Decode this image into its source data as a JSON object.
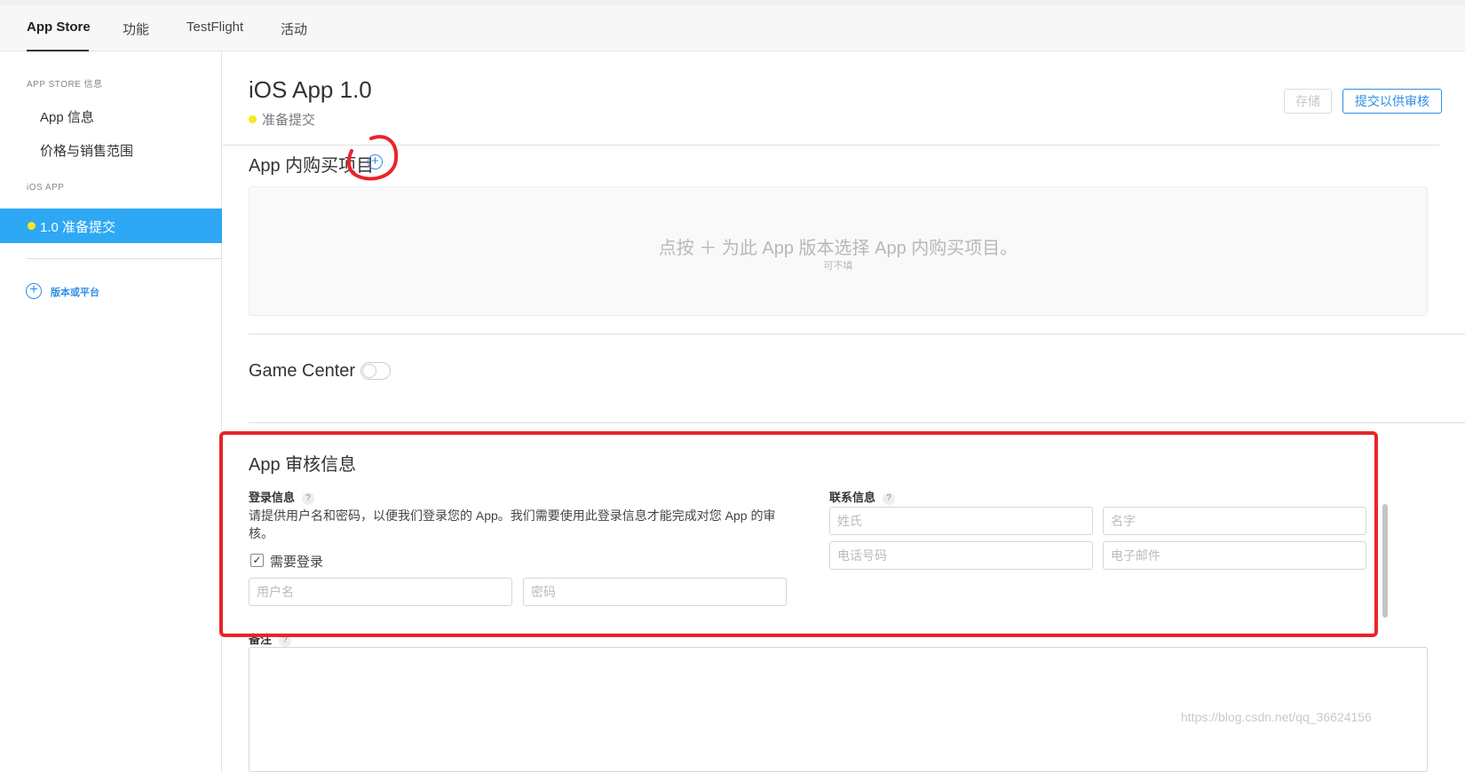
{
  "tabs": [
    {
      "label": "App Store"
    },
    {
      "label": "功能"
    },
    {
      "label": "TestFlight"
    },
    {
      "label": "活动"
    }
  ],
  "sidebar": {
    "section1_header": "APP STORE 信息",
    "items": [
      {
        "label": "App 信息"
      },
      {
        "label": "价格与销售范围"
      }
    ],
    "section2_header": "iOS APP",
    "active_version": "1.0 准备提交",
    "add_platform": "版本或平台",
    "status_dot_color": "#f8e71c",
    "active_color": "#2ea8f5"
  },
  "header": {
    "title": "iOS App 1.0",
    "status": "准备提交",
    "save_label": "存储",
    "submit_label": "提交以供审核"
  },
  "iap": {
    "title": "App 内购买项目",
    "add_icon": "plus-circle-icon",
    "hint": "点按 ＋ 为此 App 版本选择 App 内购买项目。",
    "sub": "可不填"
  },
  "game_center": {
    "title": "Game Center",
    "enabled": false
  },
  "review": {
    "title": "App 审核信息",
    "sign_in": {
      "label": "登录信息",
      "description": "请提供用户名和密码，以便我们登录您的 App。我们需要使用此登录信息才能完成对您 App 的审核。",
      "required_label": "需要登录",
      "required_checked": true,
      "username_placeholder": "用户名",
      "password_placeholder": "密码"
    },
    "contact": {
      "label": "联系信息",
      "last_name_placeholder": "姓氏",
      "first_name_placeholder": "名字",
      "phone_placeholder": "电话号码",
      "email_placeholder": "电子邮件"
    },
    "notes_label": "备注",
    "help_icon": "?"
  },
  "annotation_color": "#e8242a",
  "watermark": "https://blog.csdn.net/qq_36624156"
}
